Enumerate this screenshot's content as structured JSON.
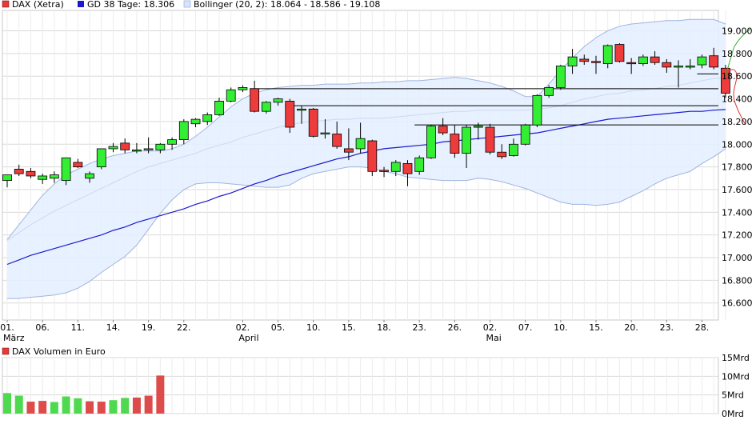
{
  "legend": {
    "price_label": "DAX (Xetra)",
    "sma_label": "GD 38 Tage: 18.306",
    "bb_label": "Bollinger (20, 2): 18.064 - 18.586 - 19.108"
  },
  "volume_legend": "DAX Volumen in Euro",
  "colors": {
    "up": "#33ee33",
    "down": "#ee3b3b",
    "sma": "#1a1acc",
    "band_fill": "#e4eeff",
    "band_line": "#9fb4de",
    "grid": "#d9d9d9",
    "level_line": "#000000",
    "volume_up": "#4fd94f",
    "volume_down": "#dd4b4b"
  },
  "chart_data": [
    {
      "type": "candlestick",
      "title": "DAX (Xetra)",
      "ylim": [
        16450,
        19180
      ],
      "y_ticks": [
        "16.600",
        "16.800",
        "17.000",
        "17.200",
        "17.400",
        "17.600",
        "17.800",
        "18.000",
        "18.200",
        "18.400",
        "18.600",
        "18.800",
        "19.000"
      ],
      "x_ticks": [
        {
          "i": 0,
          "label": "01.",
          "month": "März"
        },
        {
          "i": 3,
          "label": "06."
        },
        {
          "i": 6,
          "label": "11."
        },
        {
          "i": 9,
          "label": "14."
        },
        {
          "i": 12,
          "label": "19."
        },
        {
          "i": 15,
          "label": "22."
        },
        {
          "i": 20,
          "label": "02.",
          "month": "April"
        },
        {
          "i": 23,
          "label": "05."
        },
        {
          "i": 26,
          "label": "10."
        },
        {
          "i": 29,
          "label": "15."
        },
        {
          "i": 32,
          "label": "18."
        },
        {
          "i": 35,
          "label": "23."
        },
        {
          "i": 38,
          "label": "26."
        },
        {
          "i": 41,
          "label": "02.",
          "month": "Mai"
        },
        {
          "i": 44,
          "label": "07."
        },
        {
          "i": 47,
          "label": "10."
        },
        {
          "i": 50,
          "label": "15."
        },
        {
          "i": 53,
          "label": "20."
        },
        {
          "i": 56,
          "label": "23."
        },
        {
          "i": 59,
          "label": "28."
        }
      ],
      "candles": [
        {
          "o": 17680,
          "h": 17730,
          "l": 17620,
          "c": 17730
        },
        {
          "o": 17780,
          "h": 17820,
          "l": 17720,
          "c": 17740
        },
        {
          "o": 17760,
          "h": 17790,
          "l": 17700,
          "c": 17720
        },
        {
          "o": 17690,
          "h": 17740,
          "l": 17650,
          "c": 17720
        },
        {
          "o": 17700,
          "h": 17760,
          "l": 17660,
          "c": 17730
        },
        {
          "o": 17680,
          "h": 17880,
          "l": 17640,
          "c": 17880
        },
        {
          "o": 17840,
          "h": 17870,
          "l": 17790,
          "c": 17800
        },
        {
          "o": 17700,
          "h": 17760,
          "l": 17660,
          "c": 17740
        },
        {
          "o": 17800,
          "h": 17960,
          "l": 17780,
          "c": 17960
        },
        {
          "o": 17960,
          "h": 18010,
          "l": 17930,
          "c": 17980
        },
        {
          "o": 18010,
          "h": 18050,
          "l": 17920,
          "c": 17950
        },
        {
          "o": 17950,
          "h": 18010,
          "l": 17920,
          "c": 17950
        },
        {
          "o": 17950,
          "h": 18060,
          "l": 17920,
          "c": 17960
        },
        {
          "o": 17950,
          "h": 18010,
          "l": 17920,
          "c": 18000
        },
        {
          "o": 18000,
          "h": 18060,
          "l": 17950,
          "c": 18040
        },
        {
          "o": 18040,
          "h": 18220,
          "l": 18000,
          "c": 18200
        },
        {
          "o": 18180,
          "h": 18230,
          "l": 18150,
          "c": 18220
        },
        {
          "o": 18200,
          "h": 18280,
          "l": 18170,
          "c": 18260
        },
        {
          "o": 18260,
          "h": 18410,
          "l": 18250,
          "c": 18380
        },
        {
          "o": 18380,
          "h": 18500,
          "l": 18370,
          "c": 18480
        },
        {
          "o": 18480,
          "h": 18520,
          "l": 18460,
          "c": 18500
        },
        {
          "o": 18490,
          "h": 18560,
          "l": 18280,
          "c": 18290
        },
        {
          "o": 18290,
          "h": 18380,
          "l": 18270,
          "c": 18370
        },
        {
          "o": 18370,
          "h": 18410,
          "l": 18340,
          "c": 18400
        },
        {
          "o": 18380,
          "h": 18400,
          "l": 18100,
          "c": 18150
        },
        {
          "o": 18310,
          "h": 18340,
          "l": 18180,
          "c": 18310
        },
        {
          "o": 18310,
          "h": 18320,
          "l": 18060,
          "c": 18070
        },
        {
          "o": 18090,
          "h": 18220,
          "l": 18050,
          "c": 18100
        },
        {
          "o": 18090,
          "h": 18200,
          "l": 17960,
          "c": 17980
        },
        {
          "o": 17960,
          "h": 18140,
          "l": 17860,
          "c": 17930
        },
        {
          "o": 17960,
          "h": 18190,
          "l": 17920,
          "c": 18050
        },
        {
          "o": 18030,
          "h": 18040,
          "l": 17720,
          "c": 17760
        },
        {
          "o": 17770,
          "h": 17800,
          "l": 17710,
          "c": 17760
        },
        {
          "o": 17760,
          "h": 17860,
          "l": 17720,
          "c": 17840
        },
        {
          "o": 17830,
          "h": 17860,
          "l": 17630,
          "c": 17740
        },
        {
          "o": 17760,
          "h": 17900,
          "l": 17730,
          "c": 17880
        },
        {
          "o": 17880,
          "h": 18170,
          "l": 17870,
          "c": 18160
        },
        {
          "o": 18160,
          "h": 18230,
          "l": 18080,
          "c": 18100
        },
        {
          "o": 18090,
          "h": 18170,
          "l": 17880,
          "c": 17920
        },
        {
          "o": 17920,
          "h": 18170,
          "l": 17790,
          "c": 18150
        },
        {
          "o": 18150,
          "h": 18190,
          "l": 18040,
          "c": 18160
        },
        {
          "o": 18150,
          "h": 18180,
          "l": 17910,
          "c": 17930
        },
        {
          "o": 17930,
          "h": 18000,
          "l": 17870,
          "c": 17890
        },
        {
          "o": 17900,
          "h": 18050,
          "l": 17890,
          "c": 18000
        },
        {
          "o": 18000,
          "h": 18180,
          "l": 17990,
          "c": 18170
        },
        {
          "o": 18170,
          "h": 18440,
          "l": 18150,
          "c": 18430
        },
        {
          "o": 18430,
          "h": 18520,
          "l": 18410,
          "c": 18500
        },
        {
          "o": 18500,
          "h": 18700,
          "l": 18480,
          "c": 18690
        },
        {
          "o": 18690,
          "h": 18840,
          "l": 18620,
          "c": 18770
        },
        {
          "o": 18750,
          "h": 18790,
          "l": 18700,
          "c": 18730
        },
        {
          "o": 18730,
          "h": 18780,
          "l": 18620,
          "c": 18720
        },
        {
          "o": 18710,
          "h": 18880,
          "l": 18670,
          "c": 18870
        },
        {
          "o": 18880,
          "h": 18890,
          "l": 18720,
          "c": 18730
        },
        {
          "o": 18720,
          "h": 18760,
          "l": 18620,
          "c": 18710
        },
        {
          "o": 18710,
          "h": 18790,
          "l": 18690,
          "c": 18770
        },
        {
          "o": 18770,
          "h": 18820,
          "l": 18700,
          "c": 18720
        },
        {
          "o": 18720,
          "h": 18750,
          "l": 18630,
          "c": 18680
        },
        {
          "o": 18680,
          "h": 18740,
          "l": 18500,
          "c": 18690
        },
        {
          "o": 18690,
          "h": 18750,
          "l": 18660,
          "c": 18690
        },
        {
          "o": 18700,
          "h": 18790,
          "l": 18670,
          "c": 18770
        },
        {
          "o": 18780,
          "h": 18850,
          "l": 18660,
          "c": 18680
        },
        {
          "o": 18670,
          "h": 18700,
          "l": 18410,
          "c": 18450
        }
      ],
      "sma_38": {
        "name": "GD 38 Tage",
        "values": [
          16940,
          16980,
          17020,
          17050,
          17080,
          17110,
          17140,
          17170,
          17200,
          17240,
          17270,
          17310,
          17340,
          17370,
          17400,
          17430,
          17470,
          17500,
          17540,
          17570,
          17610,
          17650,
          17680,
          17720,
          17750,
          17780,
          17810,
          17840,
          17870,
          17890,
          17920,
          17940,
          17960,
          17970,
          17980,
          17990,
          18000,
          18020,
          18030,
          18040,
          18050,
          18060,
          18070,
          18080,
          18090,
          18100,
          18120,
          18140,
          18160,
          18180,
          18200,
          18220,
          18230,
          18240,
          18250,
          18260,
          18270,
          18280,
          18290,
          18290,
          18300,
          18306
        ]
      },
      "bollinger": {
        "name": "Bollinger (20, 2)",
        "upper": [
          17160,
          17290,
          17420,
          17550,
          17650,
          17730,
          17780,
          17830,
          17870,
          17900,
          17920,
          17940,
          17940,
          17940,
          17960,
          18000,
          18070,
          18150,
          18240,
          18330,
          18400,
          18450,
          18480,
          18500,
          18510,
          18520,
          18520,
          18530,
          18530,
          18530,
          18540,
          18540,
          18550,
          18550,
          18560,
          18560,
          18570,
          18580,
          18590,
          18580,
          18560,
          18540,
          18510,
          18470,
          18420,
          18420,
          18530,
          18650,
          18760,
          18860,
          18940,
          19000,
          19040,
          19060,
          19070,
          19080,
          19090,
          19090,
          19100,
          19100,
          19100,
          19060
        ],
        "middle": [
          17150,
          17220,
          17290,
          17350,
          17410,
          17460,
          17510,
          17560,
          17610,
          17660,
          17710,
          17760,
          17800,
          17830,
          17860,
          17890,
          17920,
          17960,
          17990,
          18020,
          18060,
          18090,
          18120,
          18150,
          18170,
          18190,
          18200,
          18210,
          18220,
          18220,
          18230,
          18230,
          18230,
          18240,
          18250,
          18260,
          18270,
          18280,
          18290,
          18290,
          18300,
          18300,
          18300,
          18300,
          18300,
          18310,
          18320,
          18340,
          18370,
          18400,
          18420,
          18440,
          18450,
          18470,
          18480,
          18490,
          18510,
          18520,
          18540,
          18560,
          18580,
          18586
        ],
        "lower": [
          16640,
          16640,
          16650,
          16660,
          16670,
          16690,
          16730,
          16790,
          16870,
          16940,
          17010,
          17110,
          17250,
          17390,
          17510,
          17600,
          17650,
          17660,
          17660,
          17650,
          17640,
          17630,
          17620,
          17620,
          17640,
          17700,
          17740,
          17760,
          17780,
          17800,
          17800,
          17790,
          17760,
          17740,
          17710,
          17700,
          17690,
          17680,
          17680,
          17680,
          17700,
          17690,
          17670,
          17640,
          17610,
          17570,
          17530,
          17490,
          17470,
          17470,
          17460,
          17470,
          17490,
          17540,
          17590,
          17650,
          17700,
          17730,
          17760,
          17830,
          17890,
          17960
        ]
      },
      "horizontal_levels": [
        {
          "y": 18620,
          "from": 59
        },
        {
          "y": 18490,
          "from": 21
        },
        {
          "y": 18340,
          "from": 24
        },
        {
          "y": 18170,
          "from": 35
        }
      ]
    },
    {
      "type": "bar",
      "title": "DAX Volumen in Euro",
      "ylim": [
        0,
        15
      ],
      "y_ticks": [
        "0Mrd",
        "5Mrd",
        "10Mrd",
        "15Mrd"
      ],
      "values": [
        5.5,
        4.8,
        3.2,
        3.4,
        3.1,
        4.6,
        4.1,
        3.3,
        3.2,
        3.6,
        4.2,
        4.3,
        4.8,
        10.2
      ],
      "directions": [
        "up",
        "up",
        "down",
        "down",
        "up",
        "up",
        "up",
        "down",
        "down",
        "up",
        "up",
        "down",
        "down",
        "down"
      ]
    }
  ]
}
